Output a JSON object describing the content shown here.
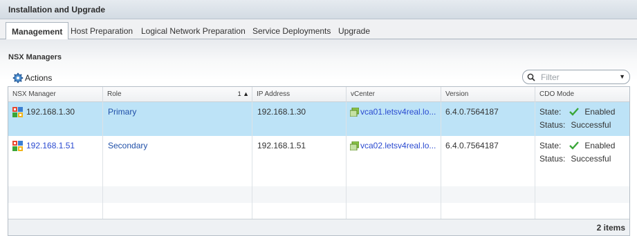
{
  "window": {
    "title": "Installation and Upgrade"
  },
  "tabs": [
    {
      "label": "Management",
      "active": true
    },
    {
      "label": "Host Preparation",
      "active": false
    },
    {
      "label": "Logical Network Preparation",
      "active": false
    },
    {
      "label": "Service Deployments",
      "active": false
    },
    {
      "label": "Upgrade",
      "active": false
    }
  ],
  "section": {
    "title": "NSX Managers"
  },
  "toolbar": {
    "actions_label": "Actions",
    "actions_icon": "gear-icon"
  },
  "filter": {
    "placeholder": "Filter",
    "icon": "search-icon"
  },
  "grid": {
    "columns": [
      "NSX Manager",
      "Role",
      "IP Address",
      "vCenter",
      "Version",
      "CDO Mode"
    ],
    "sort": {
      "column": "Role",
      "indicator": "1 ▲"
    },
    "rows": [
      {
        "nsx_manager": "192.168.1.30",
        "role": "Primary",
        "ip_address": "192.168.1.30",
        "vcenter": "vca01.letsv4real.lo...",
        "version": "6.4.0.7564187",
        "cdo_state_label": "State:",
        "cdo_state_value": "Enabled",
        "cdo_status_label": "Status:",
        "cdo_status_value": "Successful",
        "selected": true
      },
      {
        "nsx_manager": "192.168.1.51",
        "role": "Secondary",
        "ip_address": "192.168.1.51",
        "vcenter": "vca02.letsv4real.lo...",
        "version": "6.4.0.7564187",
        "cdo_state_label": "State:",
        "cdo_state_value": "Enabled",
        "cdo_status_label": "Status:",
        "cdo_status_value": "Successful",
        "selected": false
      }
    ],
    "footer_count": "2 items"
  },
  "colors": {
    "selected_row": "#bde3f7",
    "link": "#1f4fa8",
    "check": "#3aa638"
  }
}
